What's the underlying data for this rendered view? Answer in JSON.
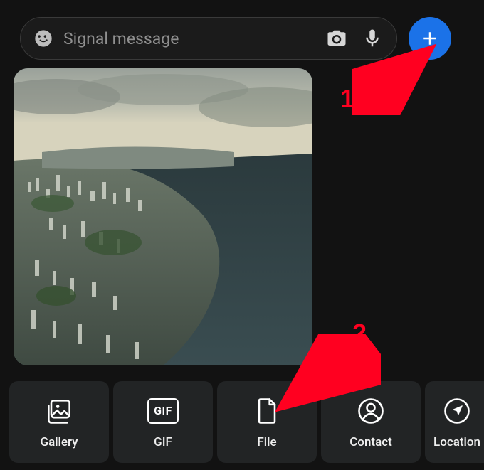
{
  "composer": {
    "placeholder": "Signal message"
  },
  "attachments": {
    "gallery": "Gallery",
    "gif": "GIF",
    "gif_box": "GIF",
    "file": "File",
    "contact": "Contact",
    "location": "Location"
  },
  "annotations": {
    "one": "1",
    "two": "2"
  },
  "colors": {
    "accent": "#1b72e8",
    "annotation": "#ff0020"
  }
}
